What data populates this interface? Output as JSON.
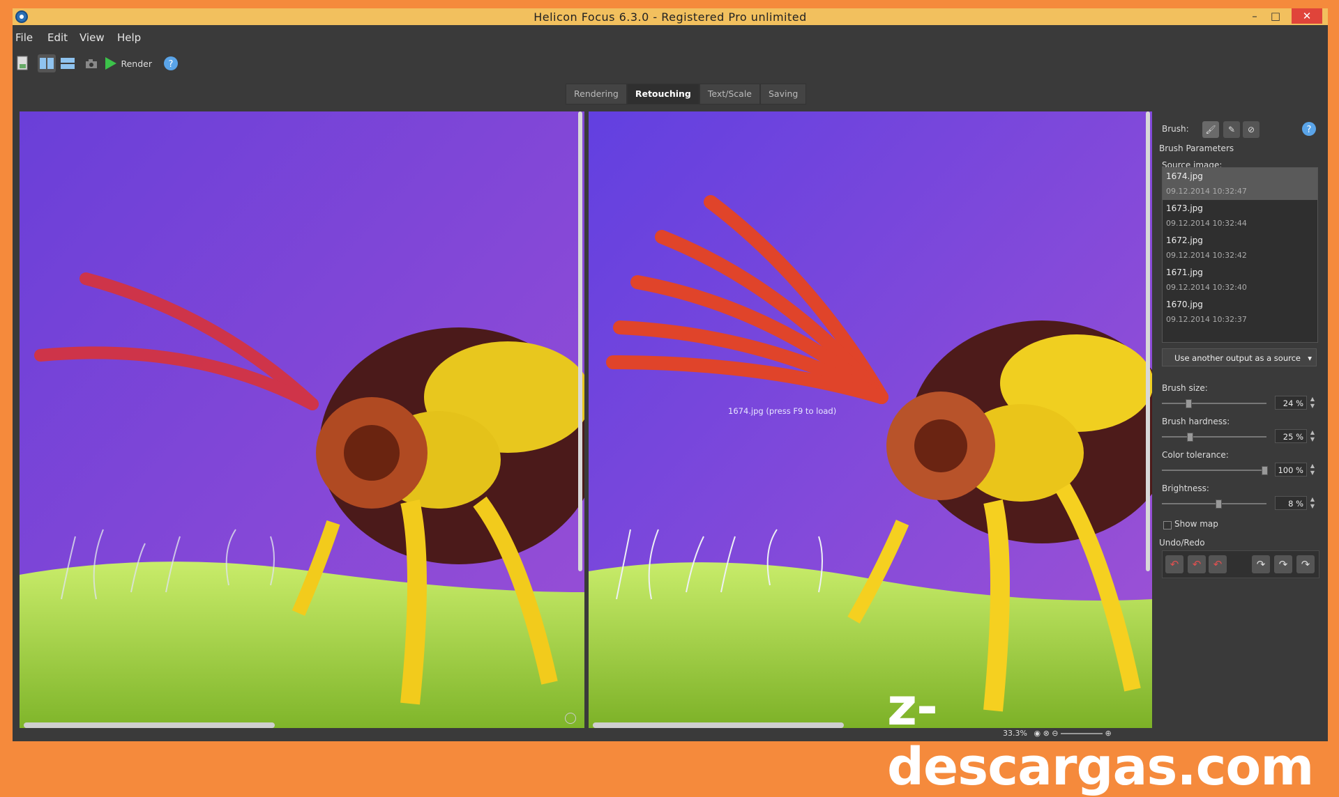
{
  "window": {
    "title": "Helicon Focus 6.3.0 - Registered Pro unlimited",
    "controls": {
      "minimize": "–",
      "maximize": "□",
      "close": "✕"
    }
  },
  "menu": [
    "File",
    "Edit",
    "View",
    "Help"
  ],
  "toolbar": {
    "render_label": "Render"
  },
  "tabs": [
    {
      "label": "Rendering",
      "active": false
    },
    {
      "label": "Retouching",
      "active": true
    },
    {
      "label": "Text/Scale",
      "active": false
    },
    {
      "label": "Saving",
      "active": false
    }
  ],
  "viewer": {
    "overlay_text": "1674.jpg (press F9 to load)"
  },
  "panel": {
    "brush_label": "Brush:",
    "brush_params_label": "Brush Parameters",
    "source_image_label": "Source image:",
    "sources": [
      {
        "name": "1674.jpg",
        "date": "09.12.2014 10:32:47",
        "selected": true
      },
      {
        "name": "1673.jpg",
        "date": "09.12.2014 10:32:44",
        "selected": false
      },
      {
        "name": "1672.jpg",
        "date": "09.12.2014 10:32:42",
        "selected": false
      },
      {
        "name": "1671.jpg",
        "date": "09.12.2014 10:32:40",
        "selected": false
      },
      {
        "name": "1670.jpg",
        "date": "09.12.2014 10:32:37",
        "selected": false
      }
    ],
    "use_other_label": "Use another output as a source",
    "brush_size": {
      "label": "Brush size:",
      "value": "24 %",
      "level": 0.24
    },
    "brush_hardness": {
      "label": "Brush hardness:",
      "value": "25 %",
      "level": 0.25
    },
    "color_tolerance": {
      "label": "Color tolerance:",
      "value": "100 %",
      "level": 1.0
    },
    "brightness": {
      "label": "Brightness:",
      "value": "8 %",
      "level": 0.54
    },
    "show_map_label": "Show map",
    "undo_redo_label": "Undo/Redo"
  },
  "status": {
    "zoom": "33.3%"
  },
  "watermark": "z-descargas.com",
  "colors": {
    "accent_title": "#f2c05e",
    "background_purple": "#7b45d7",
    "close": "#e0443a"
  }
}
